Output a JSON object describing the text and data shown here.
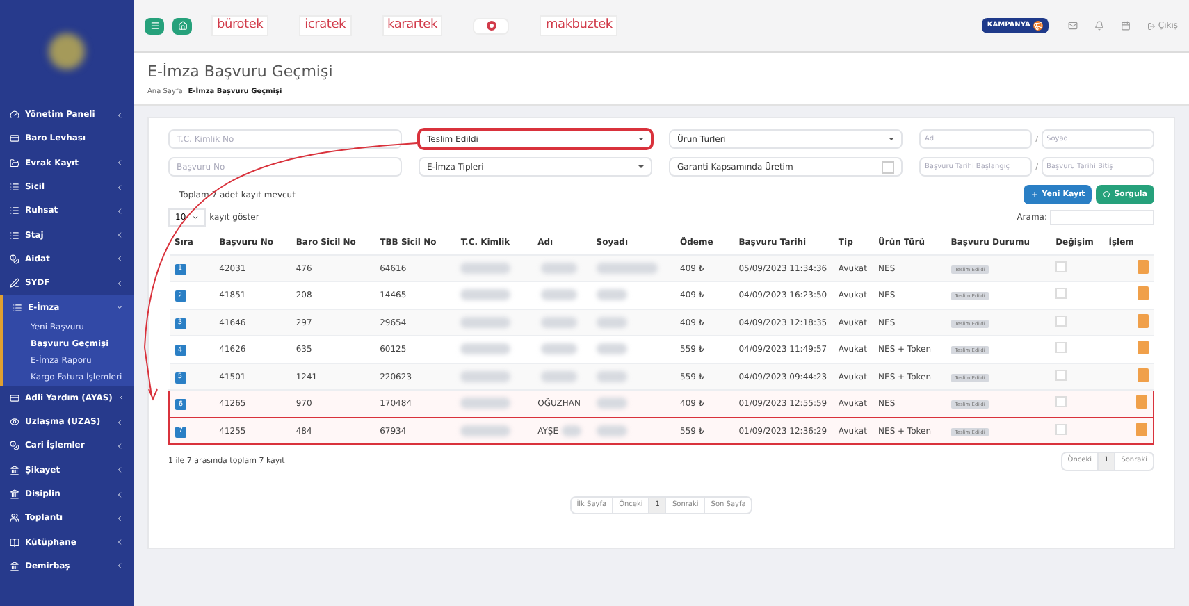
{
  "sidebar": {
    "items": [
      {
        "label": "Yönetim Paneli",
        "has_children": true,
        "expanded": false
      },
      {
        "label": "Baro Levhası",
        "has_children": false,
        "expanded": false
      },
      {
        "label": "Evrak Kayıt",
        "has_children": true,
        "expanded": false
      },
      {
        "label": "Sicil",
        "has_children": true,
        "expanded": false
      },
      {
        "label": "Ruhsat",
        "has_children": true,
        "expanded": false
      },
      {
        "label": "Staj",
        "has_children": true,
        "expanded": false
      },
      {
        "label": "Aidat",
        "has_children": true,
        "expanded": false
      },
      {
        "label": "SYDF",
        "has_children": true,
        "expanded": false
      },
      {
        "label": "E-İmza",
        "has_children": true,
        "expanded": true,
        "children": [
          {
            "label": "Yeni Başvuru",
            "selected": false
          },
          {
            "label": "Başvuru Geçmişi",
            "selected": true
          },
          {
            "label": "E-İmza Raporu",
            "selected": false
          },
          {
            "label": "Kargo Fatura İşlemleri",
            "selected": false
          }
        ]
      },
      {
        "label": "Adli Yardım (AYAS)",
        "has_children": true,
        "expanded": false
      },
      {
        "label": "Uzlaşma (UZAS)",
        "has_children": true,
        "expanded": false
      },
      {
        "label": "Cari İşlemler",
        "has_children": true,
        "expanded": false
      },
      {
        "label": "Şikayet",
        "has_children": true,
        "expanded": false
      },
      {
        "label": "Disiplin",
        "has_children": true,
        "expanded": false
      },
      {
        "label": "Toplantı",
        "has_children": true,
        "expanded": false
      },
      {
        "label": "Kütüphane",
        "has_children": true,
        "expanded": false
      },
      {
        "label": "Demirbaş",
        "has_children": true,
        "expanded": false
      }
    ]
  },
  "topbar": {
    "logos": [
      {
        "text": "bürotek"
      },
      {
        "text": "icratek"
      },
      {
        "text": "karartek"
      },
      {
        "text": "makbuztek"
      }
    ],
    "campaign": "KAMPANYA",
    "logout": "Çıkış"
  },
  "page": {
    "title": "E-İmza Başvuru Geçmişi",
    "breadcrumb": [
      "Ana Sayfa",
      "E-İmza Başvuru Geçmişi"
    ]
  },
  "filters": [
    {
      "kind": "input",
      "placeholder": "T.C. Kimlik No",
      "highlighted": false
    },
    {
      "kind": "select",
      "value": "Teslim Edildi",
      "highlighted": true
    },
    {
      "kind": "select",
      "value": "Ürün Türleri",
      "highlighted": false
    },
    {
      "kind": "pair",
      "placeholders": [
        "Ad",
        "Soyad"
      ],
      "separator": "/",
      "highlighted": false
    },
    {
      "kind": "input",
      "placeholder": "Başvuru No",
      "highlighted": false
    },
    {
      "kind": "select",
      "value": "E-İmza Tipleri",
      "highlighted": false
    },
    {
      "kind": "check",
      "value": "Garanti Kapsamında Üretim",
      "checked": false,
      "highlighted": false
    },
    {
      "kind": "pair",
      "placeholders": [
        "Başvuru Tarihi Başlangıç",
        "Başvuru Tarihi Bitiş"
      ],
      "separator": "/",
      "highlighted": false
    }
  ],
  "record_count": "Toplam 7 adet kayıt mevcut",
  "buttons": [
    {
      "label": "Yeni Kayıt",
      "kind": "new"
    },
    {
      "label": "Sorgula",
      "kind": "search"
    }
  ],
  "page_size": {
    "value": "10",
    "label": "kayıt göster"
  },
  "search_label": "Arama:",
  "table": {
    "columns": [
      "Sıra",
      "Başvuru No",
      "Baro Sicil No",
      "TBB Sicil No",
      "T.C. Kimlik",
      "Adı",
      "Soyadı",
      "Ödeme",
      "Başvuru Tarihi",
      "Tip",
      "Ürün Türü",
      "Başvuru Durumu",
      "Değişim",
      "İşlem"
    ],
    "rows": [
      {
        "sira": "1",
        "basvuru_no": "42031",
        "baro_sicil": "476",
        "tbb_sicil": "64616",
        "ad_blurred": true,
        "odeme": "409 ₺",
        "tarih": "05/09/2023 11:34:36",
        "tip": "Avukat",
        "urun": "NES",
        "durum": "Teslim Edildi",
        "degisim": false,
        "highlighted": false
      },
      {
        "sira": "2",
        "basvuru_no": "41851",
        "baro_sicil": "208",
        "tbb_sicil": "14465",
        "ad_blurred": true,
        "odeme": "409 ₺",
        "tarih": "04/09/2023 16:23:50",
        "tip": "Avukat",
        "urun": "NES",
        "durum": "Teslim Edildi",
        "degisim": false,
        "highlighted": false
      },
      {
        "sira": "3",
        "basvuru_no": "41646",
        "baro_sicil": "297",
        "tbb_sicil": "29654",
        "ad_blurred": true,
        "odeme": "409 ₺",
        "tarih": "04/09/2023 12:18:35",
        "tip": "Avukat",
        "urun": "NES",
        "durum": "Teslim Edildi",
        "degisim": false,
        "highlighted": false
      },
      {
        "sira": "4",
        "basvuru_no": "41626",
        "baro_sicil": "635",
        "tbb_sicil": "60125",
        "ad_blurred": true,
        "odeme": "559 ₺",
        "tarih": "04/09/2023 11:49:57",
        "tip": "Avukat",
        "urun": "NES + Token",
        "durum": "Teslim Edildi",
        "degisim": false,
        "highlighted": false
      },
      {
        "sira": "5",
        "basvuru_no": "41501",
        "baro_sicil": "1241",
        "tbb_sicil": "220623",
        "ad_blurred": true,
        "odeme": "559 ₺",
        "tarih": "04/09/2023 09:44:23",
        "tip": "Avukat",
        "urun": "NES + Token",
        "durum": "Teslim Edildi",
        "degisim": false,
        "highlighted": false
      },
      {
        "sira": "6",
        "basvuru_no": "41265",
        "baro_sicil": "970",
        "tbb_sicil": "170484",
        "ad": "OĞUZHAN",
        "ad_blurred": false,
        "odeme": "409 ₺",
        "tarih": "01/09/2023 12:55:59",
        "tip": "Avukat",
        "urun": "NES",
        "durum": "Teslim Edildi",
        "degisim": false,
        "highlighted": true
      },
      {
        "sira": "7",
        "basvuru_no": "41255",
        "baro_sicil": "484",
        "tbb_sicil": "67934",
        "ad": "AYŞE",
        "ad_blurred": true,
        "odeme": "559 ₺",
        "tarih": "01/09/2023 12:36:29",
        "tip": "Avukat",
        "urun": "NES + Token",
        "durum": "Teslim Edildi",
        "degisim": false,
        "highlighted": true
      }
    ]
  },
  "info": "1 ile 7 arasında toplam 7 kayıt",
  "pager_small": [
    {
      "label": "Önceki",
      "selected": false
    },
    {
      "label": "1",
      "selected": true
    },
    {
      "label": "Sonraki",
      "selected": false
    }
  ],
  "pager_bottom": [
    {
      "label": "İlk Sayfa",
      "selected": false
    },
    {
      "label": "Önceki",
      "selected": false
    },
    {
      "label": "1",
      "selected": true
    },
    {
      "label": "Sonraki",
      "selected": false
    },
    {
      "label": "Son Sayfa",
      "selected": false
    }
  ]
}
